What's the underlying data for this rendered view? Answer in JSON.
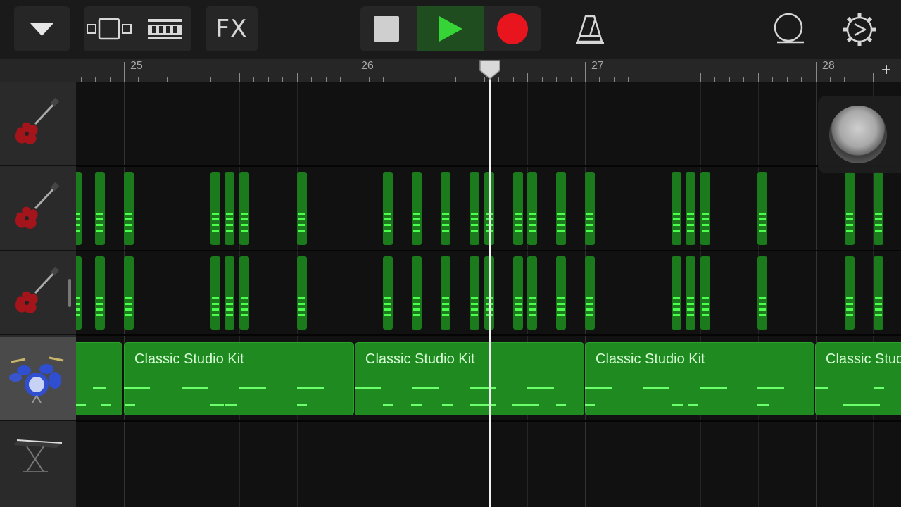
{
  "toolbar": {
    "fx_label": "FX",
    "icons": [
      "tracks-dropdown-icon",
      "loop-browser-icon",
      "mixer-icon",
      "stop-icon",
      "play-icon",
      "record-icon",
      "metronome-icon",
      "master-loop-icon",
      "settings-gear-icon"
    ]
  },
  "ruler": {
    "bar_numbers": [
      "25",
      "26",
      "27",
      "28"
    ],
    "add_section_label": "+"
  },
  "tracks": [
    {
      "instrument": "electric-guitar",
      "selected": false
    },
    {
      "instrument": "electric-guitar",
      "selected": false
    },
    {
      "instrument": "electric-guitar",
      "selected": false
    },
    {
      "instrument": "drum-kit",
      "selected": true
    },
    {
      "instrument": "keyboard",
      "selected": false
    }
  ],
  "regions": [
    {
      "name": ""
    },
    {
      "name": "Classic Studio Kit"
    },
    {
      "name": "Classic Studio Kit"
    },
    {
      "name": "Classic Studio Kit"
    },
    {
      "name": "Classic Studio Kit"
    }
  ],
  "colors": {
    "region_green": "#1f8a1f",
    "note_bright": "#4cff4c",
    "record_red": "#e8141e",
    "play_green": "#37d437"
  }
}
